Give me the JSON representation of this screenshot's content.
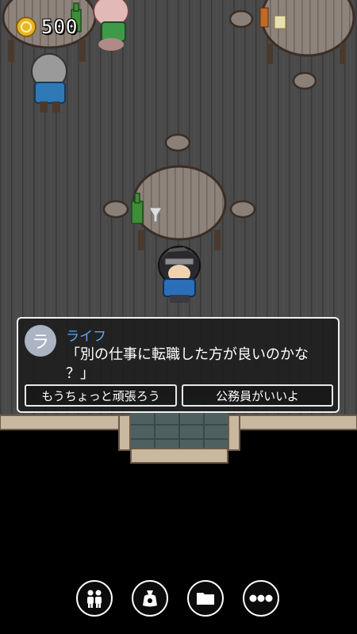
{
  "hud": {
    "coins": "500",
    "coin_icon": "gold-coin-icon"
  },
  "dialog": {
    "avatar_initial": "ラ",
    "speaker": "ライフ",
    "line1": "「別の仕事に転職した方が良いのかな",
    "line2": "？」",
    "choices": [
      "もうちょっと頑張ろう",
      "公務員がいいよ"
    ]
  },
  "bottom_menu": {
    "items": [
      {
        "icon": "party-members-icon"
      },
      {
        "icon": "item-bag-icon"
      },
      {
        "icon": "folder-icon"
      },
      {
        "icon": "more-options-icon"
      }
    ]
  },
  "colors": {
    "accent_name": "#5aa7f6",
    "floor": "#4a4a4a",
    "table": "#8a8078"
  }
}
